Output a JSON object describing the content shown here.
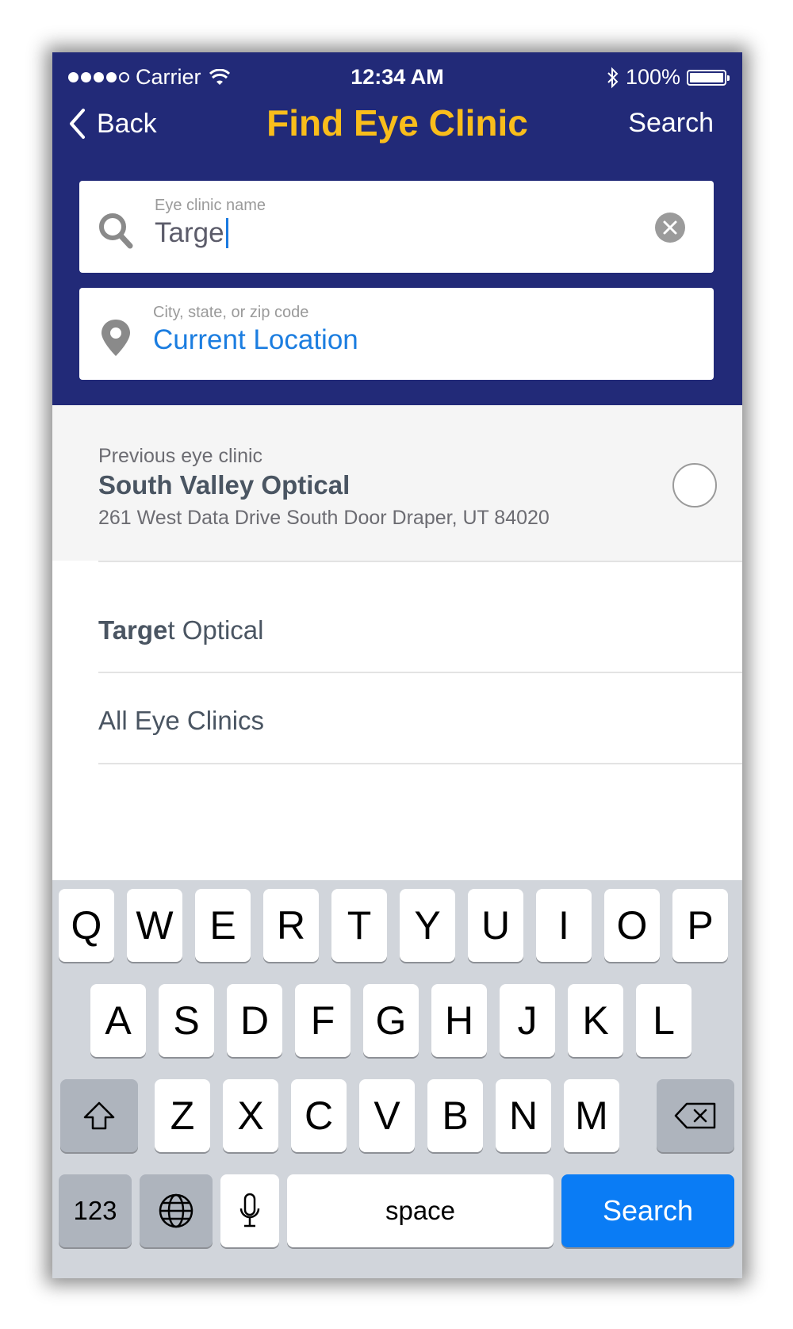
{
  "status_bar": {
    "carrier": "Carrier",
    "time": "12:34 AM",
    "battery": "100%"
  },
  "nav": {
    "back_label": "Back",
    "title": "Find Eye Clinic",
    "search_label": "Search",
    "title_color": "#f9bd1b",
    "header_color": "#222a78"
  },
  "clinic_field": {
    "label": "Eye clinic name",
    "value": "Targe"
  },
  "location_field": {
    "label": "City, state, or zip code",
    "value": "Current Location"
  },
  "previous": {
    "caption": "Previous eye clinic",
    "name": "South Valley Optical",
    "address": "261 West Data Drive South Door Draper, UT 84020"
  },
  "results": [
    {
      "match": "Targe",
      "rest": "t Optical"
    },
    {
      "match": "",
      "rest": "All Eye Clinics"
    }
  ],
  "keyboard": {
    "row1": [
      "Q",
      "W",
      "E",
      "R",
      "T",
      "Y",
      "U",
      "I",
      "O",
      "P"
    ],
    "row2": [
      "A",
      "S",
      "D",
      "F",
      "G",
      "H",
      "J",
      "K",
      "L"
    ],
    "row3": [
      "Z",
      "X",
      "C",
      "V",
      "B",
      "N",
      "M"
    ],
    "numbers_label": "123",
    "space_label": "space",
    "search_label": "Search",
    "search_color": "#0a7cf5"
  }
}
